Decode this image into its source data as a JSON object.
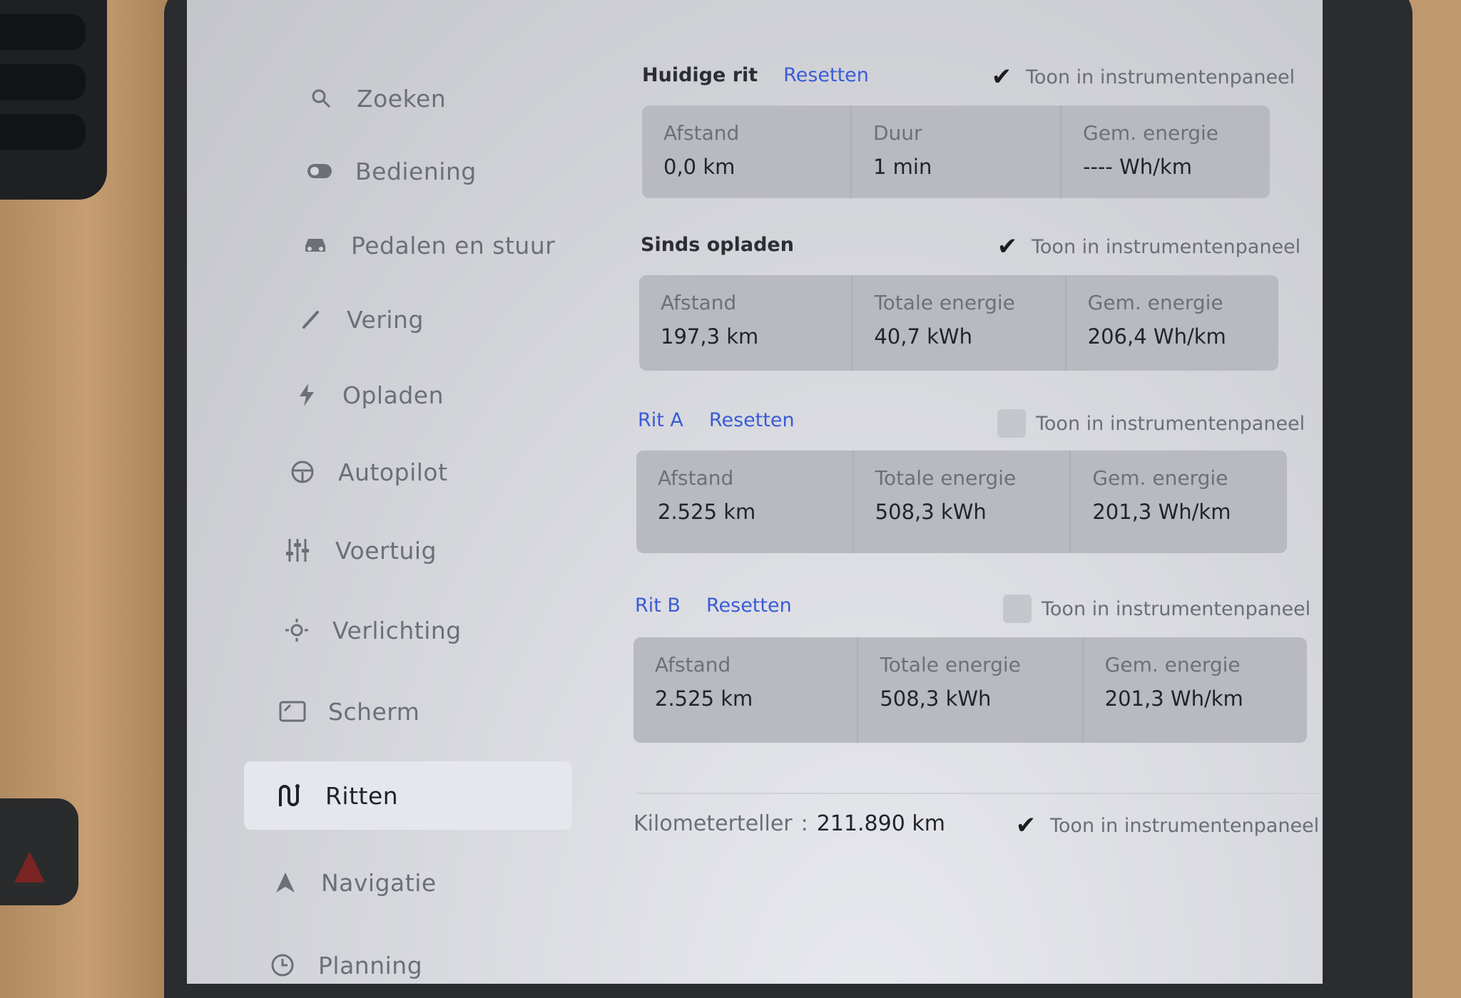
{
  "sidebar": {
    "items": [
      {
        "label": "Zoeken",
        "icon": "search-icon"
      },
      {
        "label": "Bediening",
        "icon": "toggle-icon"
      },
      {
        "label": "Pedalen en stuur",
        "icon": "car-icon"
      },
      {
        "label": "Vering",
        "icon": "wrench-icon"
      },
      {
        "label": "Opladen",
        "icon": "bolt-icon"
      },
      {
        "label": "Autopilot",
        "icon": "steering-wheel-icon"
      },
      {
        "label": "Voertuig",
        "icon": "sliders-icon"
      },
      {
        "label": "Verlichting",
        "icon": "sun-icon"
      },
      {
        "label": "Scherm",
        "icon": "display-icon"
      },
      {
        "label": "Ritten",
        "icon": "route-icon",
        "active": true
      },
      {
        "label": "Navigatie",
        "icon": "navigation-arrow-icon"
      },
      {
        "label": "Planning",
        "icon": "clock-icon"
      }
    ]
  },
  "toggle_label": "Toon in instrumentenpaneel",
  "reset_label": "Resetten",
  "sections": [
    {
      "title": "Huidige rit",
      "has_reset": true,
      "checked": true,
      "cells": [
        {
          "label": "Afstand",
          "value": "0,0  km"
        },
        {
          "label": "Duur",
          "value": "1  min"
        },
        {
          "label": "Gem. energie",
          "value": "----  Wh/km"
        }
      ]
    },
    {
      "title": "Sinds opladen",
      "has_reset": false,
      "checked": true,
      "cells": [
        {
          "label": "Afstand",
          "value": "197,3  km"
        },
        {
          "label": "Totale energie",
          "value": "40,7  kWh"
        },
        {
          "label": "Gem. energie",
          "value": "206,4  Wh/km"
        }
      ]
    },
    {
      "title": "Rit A",
      "has_reset": true,
      "checked": false,
      "cells": [
        {
          "label": "Afstand",
          "value": "2.525  km"
        },
        {
          "label": "Totale energie",
          "value": "508,3  kWh"
        },
        {
          "label": "Gem. energie",
          "value": "201,3  Wh/km"
        }
      ]
    },
    {
      "title": "Rit B",
      "has_reset": true,
      "checked": false,
      "cells": [
        {
          "label": "Afstand",
          "value": "2.525  km"
        },
        {
          "label": "Totale energie",
          "value": "508,3  kWh"
        },
        {
          "label": "Gem. energie",
          "value": "201,3  Wh/km"
        }
      ]
    }
  ],
  "odometer": {
    "label": "Kilometerteller",
    "value": "211.890  km",
    "checked": true
  }
}
